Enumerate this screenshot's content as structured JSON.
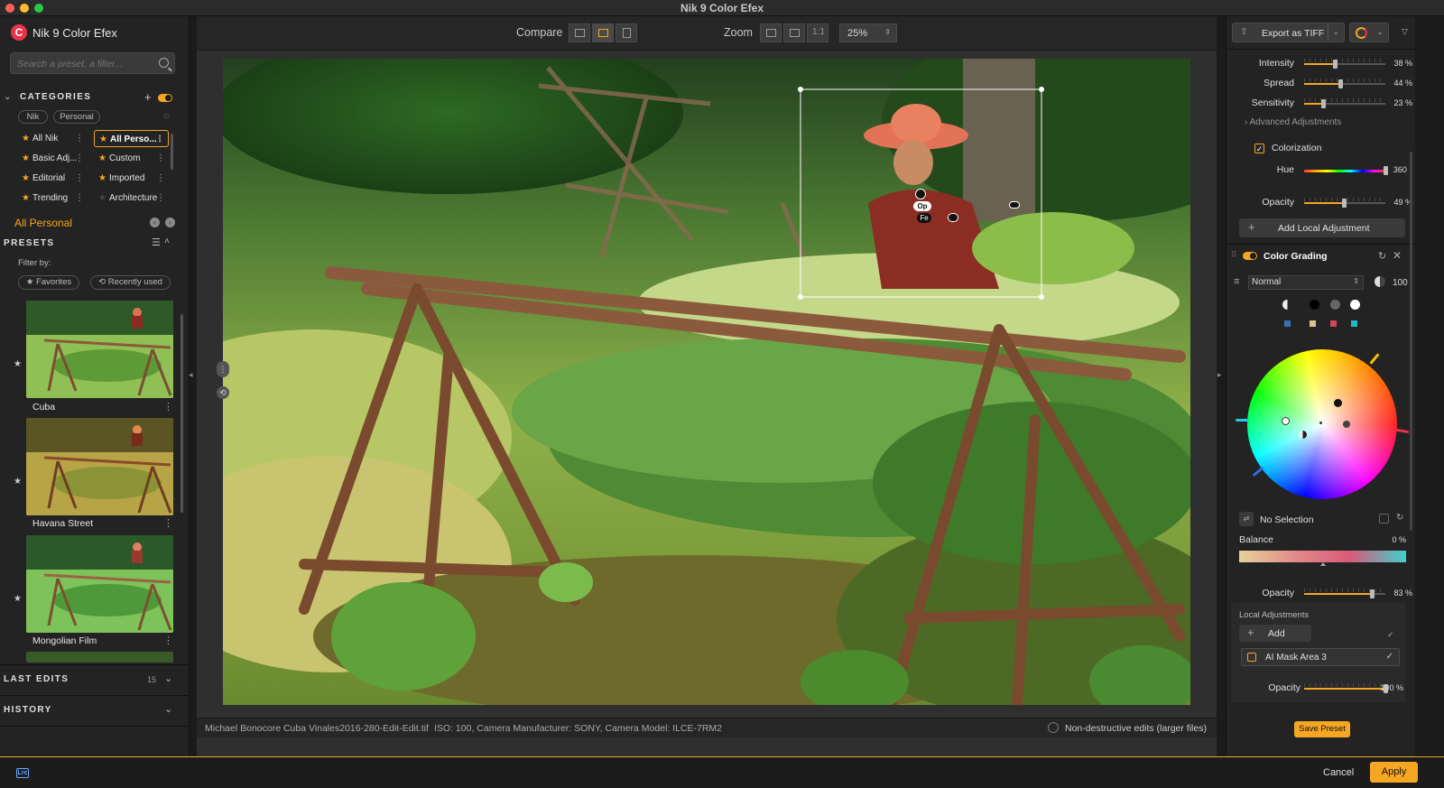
{
  "window": {
    "title": "Nik 9 Color Efex"
  },
  "app": {
    "name": "Nik 9 Color Efex"
  },
  "search": {
    "placeholder": "Search a preset, a filter..."
  },
  "categories": {
    "header": "CATEGORIES",
    "sources": [
      "Nik",
      "Personal"
    ],
    "items": [
      {
        "label": "All Nik"
      },
      {
        "label": "All Perso...",
        "selected": true
      },
      {
        "label": "Basic Adj..."
      },
      {
        "label": "Custom"
      },
      {
        "label": "Editorial"
      },
      {
        "label": "Imported"
      },
      {
        "label": "Trending"
      },
      {
        "label": "Architecture"
      }
    ],
    "current": "All Personal"
  },
  "presets": {
    "header": "PRESETS",
    "filter_label": "Filter by:",
    "filters": [
      "Favorites",
      "Recently used"
    ],
    "items": [
      {
        "name": "Cuba"
      },
      {
        "name": "Havana Street"
      },
      {
        "name": "Mongolian Film"
      }
    ]
  },
  "last_edits": {
    "header": "LAST EDITS",
    "count": "15"
  },
  "history": {
    "header": "HISTORY"
  },
  "toolbar": {
    "compare_label": "Compare",
    "zoom_label": "Zoom",
    "zoom_1to1": "1:1",
    "zoom_value": "25%"
  },
  "overlay": {
    "pin_op": "Op",
    "pin_fe": "Fe"
  },
  "status": {
    "filename": "Michael Bonocore Cuba Vinales2016-280-Edit-Edit.tif",
    "meta": "ISO: 100, Camera Manufacturer: SONY, Camera Model: ILCE-7RM2",
    "nondestructive_label": "Non-destructive edits (larger files)"
  },
  "export": {
    "label": "Export as TIFF"
  },
  "adjustments": {
    "intensity": {
      "label": "Intensity",
      "value": "38 %",
      "fraction": 0.38
    },
    "spread": {
      "label": "Spread",
      "value": "44 %",
      "fraction": 0.44
    },
    "sensitivity": {
      "label": "Sensitivity",
      "value": "23 %",
      "fraction": 0.23
    },
    "advanced_label": "Advanced Adjustments",
    "colorization_label": "Colorization",
    "hue": {
      "label": "Hue",
      "value": "360 °",
      "fraction": 1.0
    },
    "opacity": {
      "label": "Opacity",
      "value": "49 %",
      "fraction": 0.49
    },
    "add_local_label": "Add Local Adjustment"
  },
  "color_grading": {
    "title": "Color Grading",
    "blend_mode": "Normal",
    "opacity_value": "100",
    "selection_label": "No Selection",
    "balance_label": "Balance",
    "balance_value": "0 %",
    "balance_fraction": 0.5,
    "opacity": {
      "label": "Opacity",
      "value": "83 %",
      "fraction": 0.83
    },
    "tones": [
      "#d8d8d8",
      "#000000",
      "#666666",
      "#ffffff"
    ],
    "swatches": [
      "#3a6fb5",
      "#d9c38f",
      "#d6445a",
      "#21b7c4"
    ]
  },
  "local_adjustments": {
    "title": "Local Adjustments",
    "add_label": "Add",
    "items": [
      {
        "name": "AI Mask Area 3"
      }
    ],
    "opacity": {
      "label": "Opacity",
      "value": "100 %",
      "fraction": 1.0
    }
  },
  "save_preset_label": "Save Preset",
  "footer": {
    "lrc_label": "Lrc",
    "cancel_label": "Cancel",
    "apply_label": "Apply"
  },
  "colors": {
    "accent": "#f5a623",
    "brand": "#e8334a"
  }
}
